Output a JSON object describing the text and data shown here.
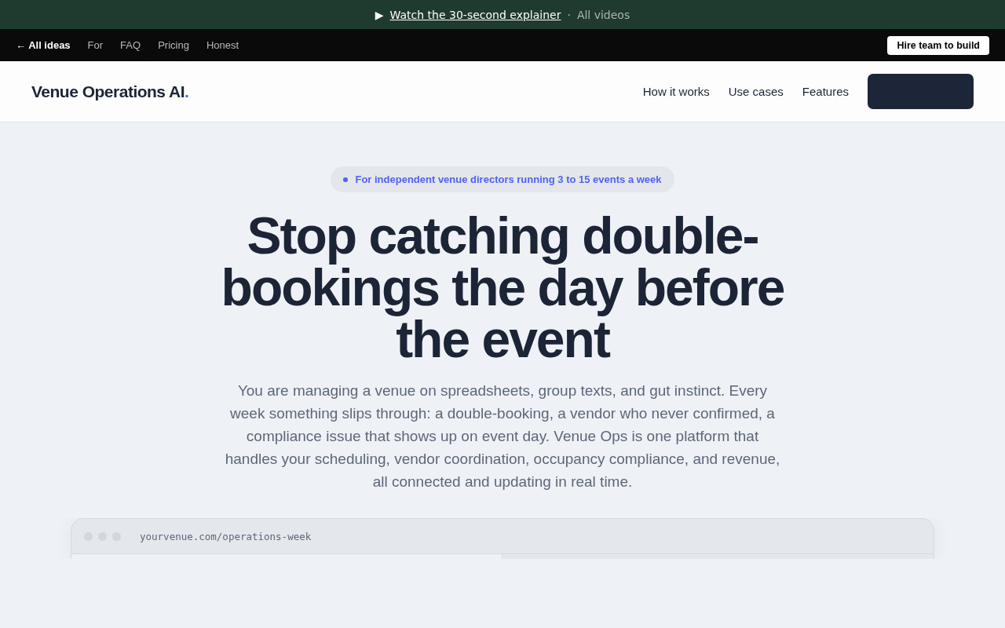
{
  "announcement": {
    "play": "▶",
    "link": "Watch the 30-second explainer",
    "separator": "·",
    "secondary": "All videos"
  },
  "topbar": {
    "back": "← All ideas",
    "links": [
      "For",
      "FAQ",
      "Pricing",
      "Honest"
    ],
    "button": "Hire team to build"
  },
  "header": {
    "logo": "Venue Operations AI",
    "logo_mark": ".",
    "nav": [
      "How it works",
      "Use cases",
      "Features"
    ]
  },
  "hero": {
    "badge": "For independent venue directors running 3 to 15 events a week",
    "title": "Stop catching double-bookings the day before the event",
    "body": "You are managing a venue on spreadsheets, group texts, and gut instinct. Every week something slips through: a double-booking, a vendor who never confirmed, a compliance issue that shows up on event day. Venue Ops is one platform that handles your scheduling, vendor coordination, occupancy compliance, and revenue, all connected and updating in real time."
  },
  "preview": {
    "url": "yourvenue.com/operations-week"
  }
}
